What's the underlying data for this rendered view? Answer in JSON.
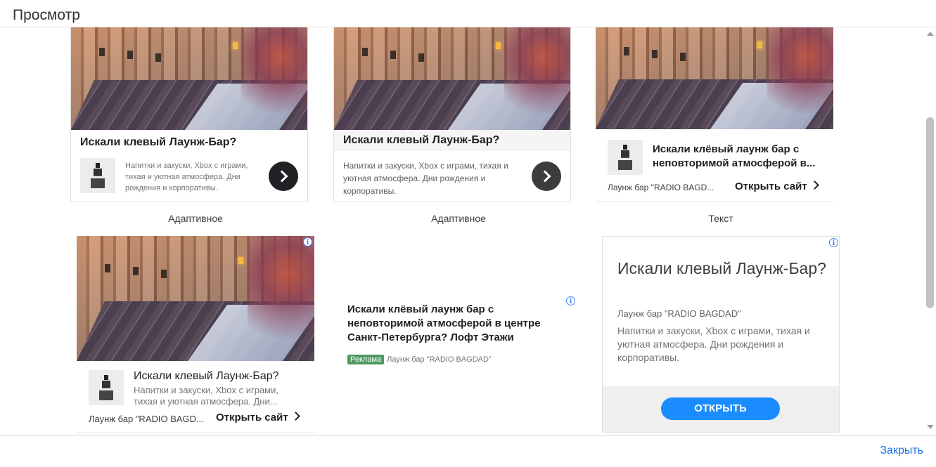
{
  "dialog": {
    "title": "Просмотр",
    "close_label": "Закрыть"
  },
  "ads": {
    "card1": {
      "headline": "Искали клевый Лаунж-Бар?",
      "description": "Напитки и закуски, Xbox с играми, тихая и уютная атмосфера. Дни рождения и корпоративы.",
      "caption": "Адаптивное"
    },
    "card2": {
      "headline": "Искали клевый Лаунж-Бар?",
      "description": "Напитки и закуски, Xbox с играми, тихая и уютная атмосфера. Дни рождения и корпоративы.",
      "caption": "Адаптивное"
    },
    "card3": {
      "headline": "Искали клёвый лаунж бар с неповторимой атмосферой в...",
      "advertiser": "Лаунж бар \"RADIO BAGD...",
      "cta": "Открыть сайт",
      "caption": "Текст"
    },
    "card4": {
      "headline": "Искали клевый Лаунж-Бар?",
      "description": "Напитки и закуски, Xbox с играми, тихая и уютная атмосфера. Дни...",
      "advertiser": "Лаунж бар \"RADIO BAGD...",
      "cta": "Открыть сайт"
    },
    "card5": {
      "headline": "Искали клёвый лаунж бар с неповторимой атмосферой в центре Санкт-Петербурга? Лофт Этажи",
      "badge": "Реклама",
      "advertiser": "Лаунж бар \"RADIO BAGDAD\""
    },
    "card6": {
      "headline": "Искали клевый Лаунж-Бар?",
      "advertiser": "Лаунж бар \"RADIO BAGDAD\"",
      "description": "Напитки и закуски, Xbox с играми, тихая и уютная атмосфера. Дни рождения и корпоративы.",
      "button": "ОТКРЫТЬ"
    },
    "info_glyph": "i"
  },
  "colors": {
    "accent": "#1a73e8",
    "button_blue": "#1a8cff",
    "badge_green": "#4f9a62",
    "dark_circle": "#202124"
  }
}
